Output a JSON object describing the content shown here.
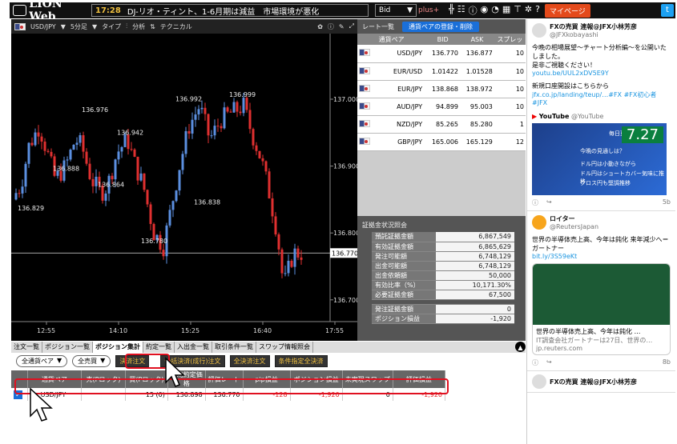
{
  "header": {
    "brand": "LION Web",
    "time": "17:28",
    "headline": "DJ-リオ・ティント、1-6月期は減益　市場環境が悪化",
    "bid_select": "Bid",
    "plus": "plus+",
    "mypage": "マイページ"
  },
  "chart": {
    "pair": "USD/JPY",
    "timeframe": "5分足",
    "type": "タイプ",
    "analysis": "分析",
    "technical": "テクニカル",
    "price_labels": [
      "137.000",
      "136.900",
      "136.800",
      "136.700"
    ],
    "current": "136.770",
    "time_labels": [
      "12:55",
      "14:10",
      "15:25",
      "16:40",
      "17:55"
    ],
    "annotations": [
      "136.976",
      "136.942",
      "136.888",
      "136.864",
      "136.829",
      "136.992",
      "136.999",
      "136.838",
      "136.780"
    ]
  },
  "rates": {
    "tab": "レート一覧",
    "register": "通貨ペアの登録・削除",
    "headers": [
      "通貨ペア",
      "BID",
      "ASK",
      "スプレッ"
    ],
    "rows": [
      {
        "pair": "USD/JPY",
        "bid": "136.770",
        "ask": "136.877",
        "sp": "10"
      },
      {
        "pair": "EUR/USD",
        "bid": "1.01422",
        "ask": "1.01528",
        "sp": "10"
      },
      {
        "pair": "EUR/JPY",
        "bid": "138.868",
        "ask": "138.972",
        "sp": "10"
      },
      {
        "pair": "AUD/JPY",
        "bid": "94.899",
        "ask": "95.003",
        "sp": "10"
      },
      {
        "pair": "NZD/JPY",
        "bid": "85.265",
        "ask": "85.280",
        "sp": "1"
      },
      {
        "pair": "GBP/JPY",
        "bid": "165.006",
        "ask": "165.129",
        "sp": "12"
      }
    ]
  },
  "account": {
    "title": "証拠金状況照会",
    "rows": [
      {
        "label": "預託証拠金額",
        "value": "6,867,549"
      },
      {
        "label": "有効証拠金額",
        "value": "6,865,629"
      },
      {
        "label": "発注可能額",
        "value": "6,748,129"
      },
      {
        "label": "出金可能額",
        "value": "6,748,129"
      },
      {
        "label": "出金依頼額",
        "value": "50,000"
      },
      {
        "label": "有効比率（%）",
        "value": "10,171.30%"
      },
      {
        "label": "必要証拠金額",
        "value": "67,500"
      },
      {
        "label": "発注証拠金額",
        "value": "0"
      },
      {
        "label": "ポジション損益",
        "value": "-1,920"
      }
    ]
  },
  "tabs": [
    "注文一覧",
    "ポジション一覧",
    "ポジション集計",
    "約定一覧",
    "入出金一覧",
    "取引条件一覧",
    "スワップ情報照会"
  ],
  "controls": {
    "pair_select": "全通貨ペア",
    "side_select": "全売買",
    "b1": "決済注文",
    "b2": "一括決済(成行)注文",
    "b3": "全決済注文",
    "b4": "条件指定全決済"
  },
  "positions": {
    "headers": [
      "",
      "通貨ペア",
      "売(Pロック)",
      "買(Pロック)",
      "平均約定価格",
      "評価レート",
      "pip損益",
      "ポジション損益",
      "未実現スワップ",
      "評価損益"
    ],
    "row": [
      "USD/JPY",
      "",
      "15 (0)",
      "136.898",
      "136.770",
      "-128",
      "-1,920",
      "0",
      "-1,920"
    ]
  },
  "tweets": [
    {
      "name": "FXの売買 連報@JFX小林芳彦",
      "handle": "@JFXkobayashi",
      "text": "今晩の相場展望〜チャート分析編〜を公開いたしました。",
      "text2": "是非ご視聴ください！",
      "link": "youtu.be/UUL2xDV5E9Y",
      "text3": "新規口座開設はこちらから",
      "link2": "jfx.co.jp/landing/teup/…#FX #FX初心者 #JFX",
      "sub": "YouTube",
      "subh": "@YouTube",
      "badge": "7.27",
      "badge_label": "毎日更新",
      "vtitle": "今晩の見通しは？",
      "vt1": "ドル円は小動きながら",
      "vt2": "ドル円はショートカバー気味に推移",
      "vt3": "クロス円も堅調推移",
      "likes": "5b"
    },
    {
      "name": "ロイター",
      "handle": "@ReutersJapan",
      "text": "世界の半導体売上高、今年は鈍化 来年減少へ＝ガートナー",
      "link": "bit.ly/3S59eKt",
      "ctitle": "世界の半導体売上高、今年は鈍化 …",
      "cbody": "IT調査会社ガートナーは27日、世界の…",
      "cdomain": "jp.reuters.com",
      "likes": "8b"
    },
    {
      "name": "FXの売買 連報@JFX小林芳彦",
      "handle": ""
    }
  ]
}
